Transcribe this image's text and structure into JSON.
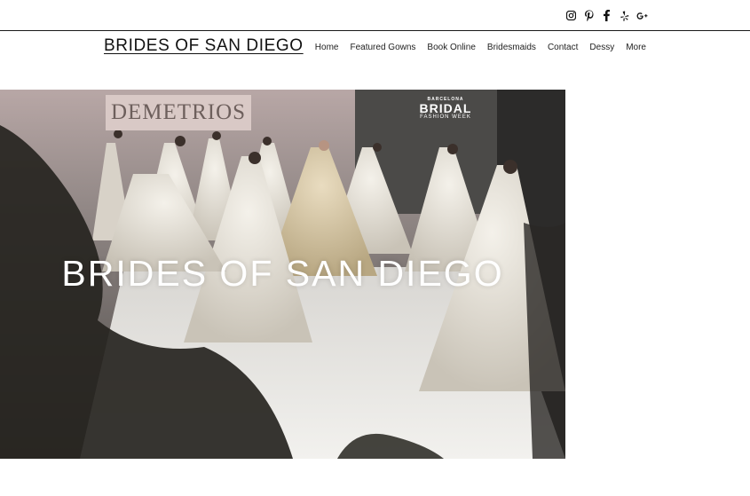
{
  "social": {
    "icons": [
      "instagram-icon",
      "pinterest-icon",
      "facebook-icon",
      "yelp-icon",
      "google-plus-icon"
    ]
  },
  "header": {
    "site_title": "BRIDES OF SAN DIEGO",
    "nav": [
      "Home",
      "Featured Gowns",
      "Book Online",
      "Bridesmaids",
      "Contact",
      "Dessy",
      "More"
    ]
  },
  "hero": {
    "title": "BRIDES OF SAN DIEGO",
    "backdrop_sign": "DEMETRIOS",
    "event_logo": {
      "line1": "BARCELONA",
      "line2": "BRIDAL",
      "line3": "FASHION WEEK"
    }
  },
  "colors": {
    "text": "#111111",
    "hero_overlay_text": "#ffffff",
    "border": "#1a1a1a"
  }
}
